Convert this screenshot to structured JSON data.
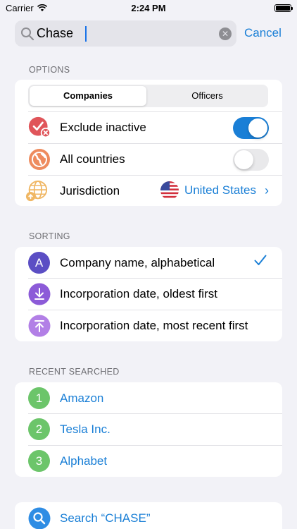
{
  "status_bar": {
    "carrier": "Carrier",
    "time": "2:24 PM"
  },
  "search": {
    "query": "Chase",
    "cancel_label": "Cancel"
  },
  "options": {
    "header": "OPTIONS",
    "segments": [
      "Companies",
      "Officers"
    ],
    "selected_segment": "Companies",
    "exclude_inactive": {
      "label": "Exclude inactive",
      "on": true
    },
    "all_countries": {
      "label": "All countries",
      "on": false
    },
    "jurisdiction": {
      "label": "Jurisdiction",
      "value": "United States"
    }
  },
  "sorting": {
    "header": "SORTING",
    "items": [
      {
        "icon_letter": "A",
        "label": "Company name, alphabetical",
        "selected": true
      },
      {
        "label": "Incorporation date, oldest first",
        "selected": false
      },
      {
        "label": "Incorporation date, most recent first",
        "selected": false
      }
    ]
  },
  "recent": {
    "header": "RECENT SEARCHED",
    "items": [
      {
        "num": "1",
        "label": "Amazon"
      },
      {
        "num": "2",
        "label": "Tesla Inc."
      },
      {
        "num": "3",
        "label": "Alphabet"
      }
    ]
  },
  "search_action": {
    "label": "Search “CHASE”"
  },
  "colors": {
    "accent": "#1a7fd6",
    "red_icon": "#e0555a",
    "orange_icon": "#ee8b5e",
    "yellow_icon": "#f0b764",
    "sort_a": "#5b4ec4",
    "sort_oldest": "#8c5bd8",
    "sort_recent": "#b27fe6",
    "recent_green": "#6cc56a"
  },
  "icons": {
    "exclude_inactive": "check-x-icon",
    "all_countries": "globe-icon",
    "jurisdiction": "globe-pin-icon",
    "sort_oldest": "download-arrow-icon",
    "sort_recent": "upload-arrow-icon",
    "search": "magnifier-icon"
  }
}
